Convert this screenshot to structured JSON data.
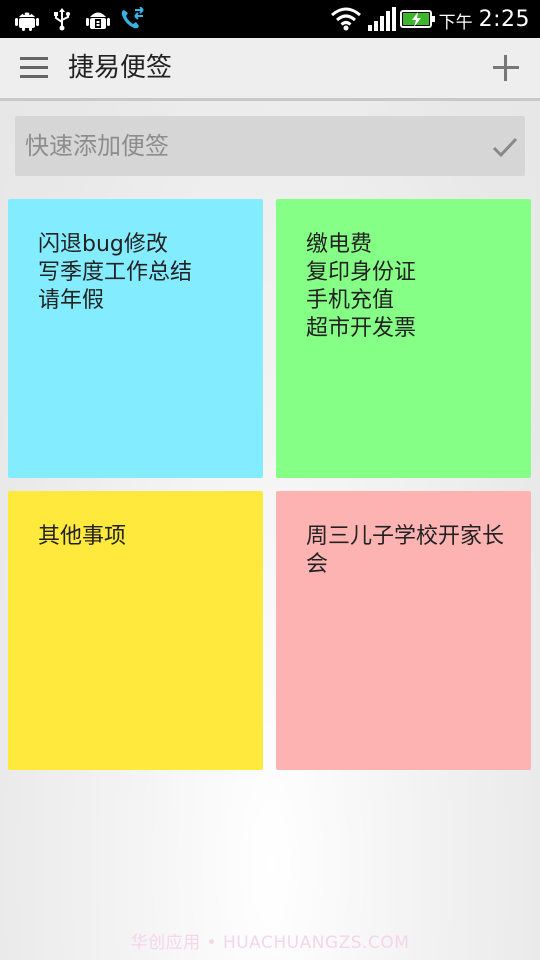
{
  "status_bar": {
    "ampm": "下午",
    "time": "2:25"
  },
  "app": {
    "title": "捷易便签"
  },
  "quick_add": {
    "placeholder": "快速添加便签",
    "value": ""
  },
  "notes": [
    {
      "color": "#84ecff",
      "lines": [
        "闪退bug修改",
        "写季度工作总结",
        "请年假"
      ]
    },
    {
      "color": "#86ff86",
      "lines": [
        "缴电费",
        "复印身份证",
        "手机充值",
        "超市开发票"
      ]
    },
    {
      "color": "#ffe93c",
      "lines": [
        "其他事项"
      ]
    },
    {
      "color": "#feb3b3",
      "lines": [
        "周三儿子学校开家长会"
      ]
    }
  ],
  "watermark": "华创应用 • HUACHUANGZS.COM"
}
